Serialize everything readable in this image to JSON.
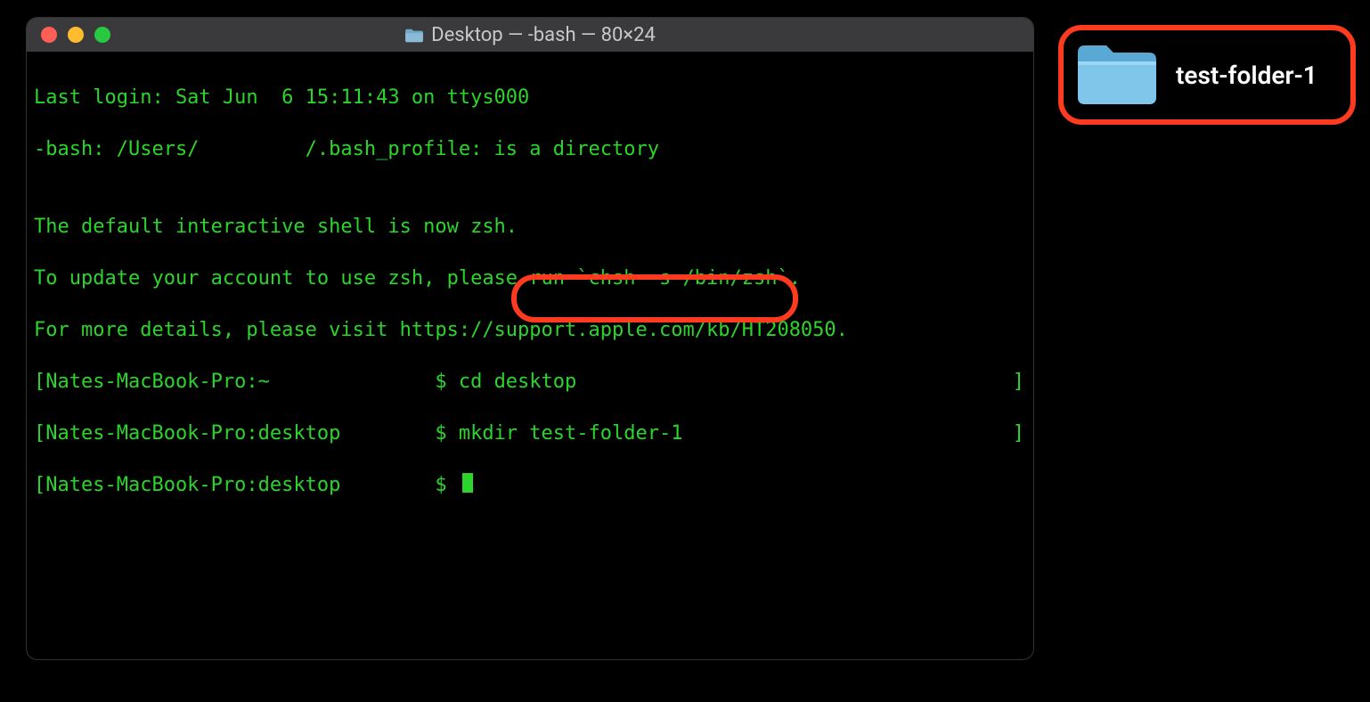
{
  "window": {
    "title": "Desktop — -bash — 80×24"
  },
  "terminal": {
    "lines": {
      "l0": "Last login: Sat Jun  6 15:11:43 on ttys000",
      "l1": "-bash: /Users/         /.bash_profile: is a directory",
      "l2": "",
      "l3": "The default interactive shell is now zsh.",
      "l4": "To update your account to use zsh, please run `chsh -s /bin/zsh`.",
      "l5": "For more details, please visit https://support.apple.com/kb/HT208050.",
      "p1_prompt": "[Nates-MacBook-Pro:~              $ ",
      "p1_cmd": "cd desktop",
      "p2_prompt": "[Nates-MacBook-Pro:desktop        $ ",
      "p2_cmd": "mkdir test-folder-1",
      "p3_prompt": "[Nates-MacBook-Pro:desktop        $ ",
      "close_bracket": "]"
    }
  },
  "desktop_item": {
    "label": "test-folder-1"
  },
  "colors": {
    "highlight": "#ff3b1f",
    "term_fg": "#2bd52b",
    "titlebar_bg": "#3a3a3c",
    "folder_fill": "#76c3e8",
    "folder_tab": "#5aa9d4"
  }
}
